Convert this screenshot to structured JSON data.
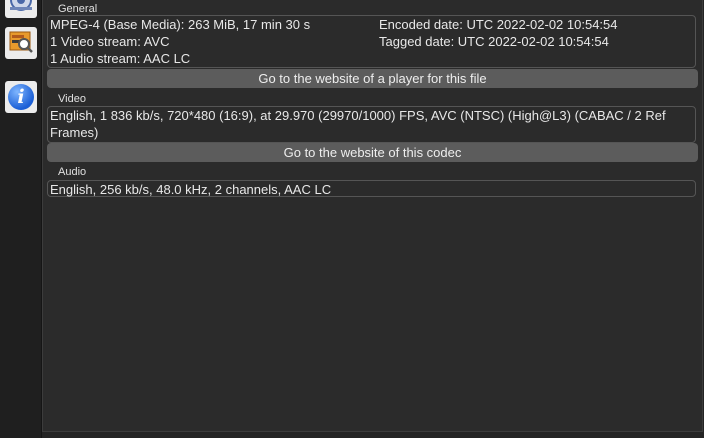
{
  "sidebar": {
    "items": [
      {
        "icon": "media-info-icon"
      },
      {
        "icon": "file-search-icon"
      },
      {
        "icon": "info-icon",
        "glyph": "i"
      }
    ]
  },
  "general": {
    "title": "General",
    "left_lines": [
      "MPEG-4 (Base Media): 263 MiB, 17 min 30 s",
      "1 Video stream: AVC",
      "1 Audio stream: AAC LC"
    ],
    "right_lines": [
      "Encoded date: UTC 2022-02-02 10:54:54",
      "Tagged date: UTC 2022-02-02 10:54:54"
    ],
    "button_label": "Go to the website of a player for this file"
  },
  "video": {
    "title": "Video",
    "text": "English, 1 836 kb/s, 720*480 (16:9), at 29.970 (29970/1000) FPS, AVC (NTSC) (High@L3) (CABAC / 2 Ref Frames)",
    "button_label": "Go to the website of this codec"
  },
  "audio": {
    "title": "Audio",
    "text": "English, 256 kb/s, 48.0 kHz, 2 channels, AAC LC"
  },
  "colors": {
    "background": "#242424",
    "panel": "#2b2b2b",
    "button": "#5c5c5c",
    "info_blue": "#1b5fd6"
  }
}
